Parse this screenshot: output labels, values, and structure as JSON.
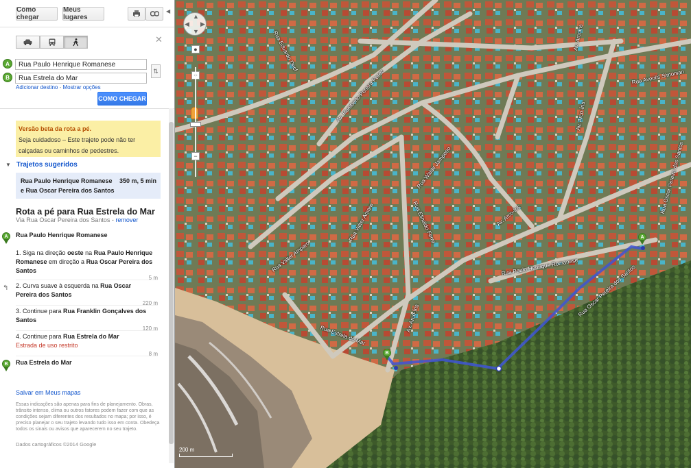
{
  "toolbar": {
    "get_directions": "Como chegar",
    "my_places": "Meus lugares",
    "print_icon": "print-icon",
    "link_icon": "link-icon"
  },
  "modes": {
    "car": "car-icon",
    "transit": "transit-icon",
    "walk": "walk-icon"
  },
  "waypoints": [
    {
      "marker": "A",
      "value": "Rua Paulo Henrique Romanese"
    },
    {
      "marker": "B",
      "value": "Rua Estrela do Mar"
    }
  ],
  "links": {
    "add_destination": "Adicionar destino",
    "separator": " - ",
    "show_options": "Mostrar opções"
  },
  "go_button": "COMO CHEGAR",
  "beta": {
    "title": "Versão beta da rota a pé.",
    "text": "Seja cuidadoso – Este trajeto pode não ter calçadas ou caminhos de pedestres."
  },
  "suggested": {
    "heading": "Trajetos sugeridos",
    "route": "Rua Paulo Henrique Romanese e Rua Oscar Pereira dos Santos",
    "distance": "350 m, 5 min"
  },
  "route": {
    "title": "Rota a pé para Rua Estrela do Mar",
    "via": "Via Rua Oscar Pereira dos Santos - ",
    "remove": "remover",
    "start": "Rua Paulo Henrique Romanese",
    "end": "Rua Estrela do Mar",
    "steps": [
      {
        "pre": "1. Siga na direção ",
        "b1": "oeste",
        "mid1": " na ",
        "b2": "Rua Paulo Henrique Romanese",
        "mid2": " em direção a ",
        "b3": "Rua Oscar Pereira dos Santos",
        "dist": "5 m"
      },
      {
        "pre": "2. Curva suave à esquerda na ",
        "b1": "Rua Oscar Pereira dos Santos",
        "dist": "220 m"
      },
      {
        "pre": "3. Continue para ",
        "b1": "Rua Franklin Gonçalves dos Santos",
        "dist": "120 m"
      },
      {
        "pre": "4. Continue para ",
        "b1": "Rua Estrela do Mar",
        "note": "Estrada de uso restrito",
        "dist": "8 m"
      }
    ]
  },
  "save_link": "Salvar em Meus mapas",
  "disclaimer": "Essas indicações são apenas para fins de planejamento. Obras, trânsito intenso, clima ou outros fatores podem fazer com que as condições sejam diferentes dos resultados no mapa; por isso, é preciso planejar o seu trajeto levando tudo isso em conta. Obedeça todos os sinais ou avisos que aparecerem no seu trajeto.",
  "copyright": "Dados cartográficos ©2014 Google",
  "map": {
    "scale_label": "200 m",
    "marker_a": "A",
    "marker_b": "B",
    "streets": [
      "Rua Eduardo Decf",
      "Av. Humberto Pereira Perez",
      "Av. Arcoiris",
      "Rua Waldir Jamperio",
      "Rua Valter Amaro",
      "Rua Elinaldo Ferro",
      "Av. Arco-Íris",
      "Rua Paulo Henrique Romanese",
      "Rua Oscar Pereira dos Santos",
      "Rua Estrela do Mar",
      "Av. Arco-Íris",
      "Rua Valter Amparo",
      "Rua Aveolis Simonian",
      "Av. Arco-Íris",
      "Rua Oscar Pereira dos Santos"
    ]
  }
}
